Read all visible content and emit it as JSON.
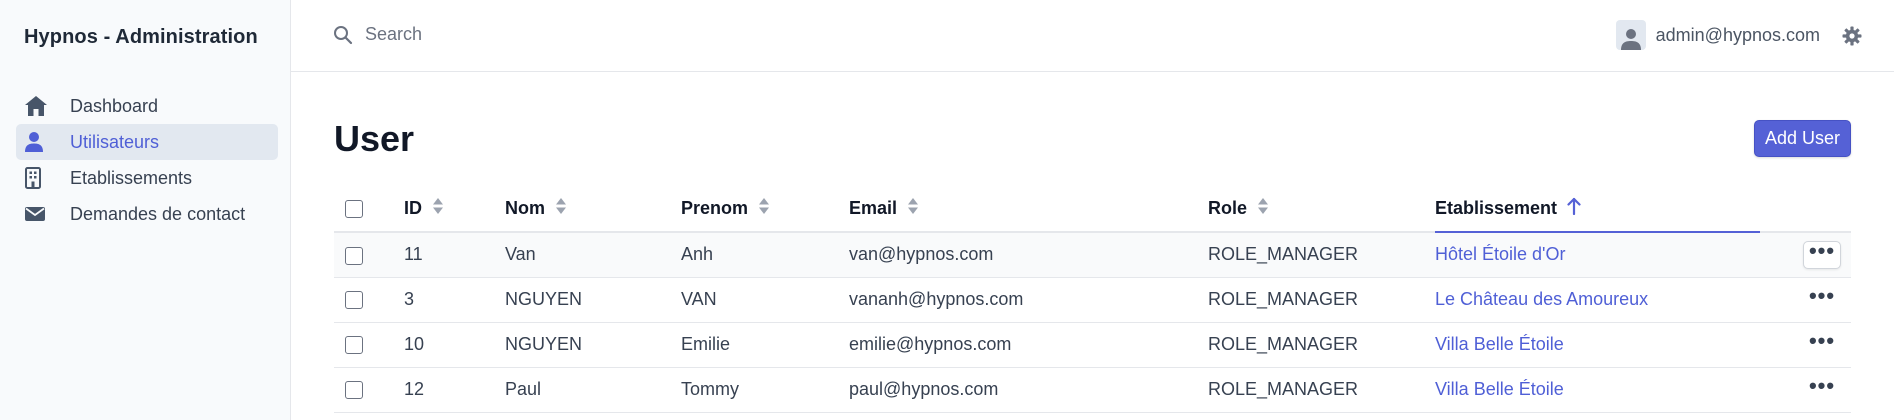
{
  "app": {
    "title": "Hypnos - Administration"
  },
  "sidebar": {
    "items": [
      {
        "label": "Dashboard",
        "icon": "home-icon",
        "active": false
      },
      {
        "label": "Utilisateurs",
        "icon": "user-icon",
        "active": true
      },
      {
        "label": "Etablissements",
        "icon": "building-icon",
        "active": false
      },
      {
        "label": "Demandes de contact",
        "icon": "envelope-icon",
        "active": false
      }
    ]
  },
  "header": {
    "search_placeholder": "Search",
    "user_email": "admin@hypnos.com"
  },
  "page": {
    "title": "User",
    "add_button": "Add User"
  },
  "table": {
    "columns": [
      "ID",
      "Nom",
      "Prenom",
      "Email",
      "Role",
      "Etablissement"
    ],
    "sorted_column": "Etablissement",
    "sort_direction": "asc",
    "rows": [
      {
        "id": "11",
        "nom": "Van",
        "prenom": "Anh",
        "email": "van@hypnos.com",
        "role": "ROLE_MANAGER",
        "etablissement": "Hôtel Étoile d'Or"
      },
      {
        "id": "3",
        "nom": "NGUYEN",
        "prenom": "VAN",
        "email": "vananh@hypnos.com",
        "role": "ROLE_MANAGER",
        "etablissement": "Le Château des Amoureux"
      },
      {
        "id": "10",
        "nom": "NGUYEN",
        "prenom": "Emilie",
        "email": "emilie@hypnos.com",
        "role": "ROLE_MANAGER",
        "etablissement": "Villa Belle Étoile"
      },
      {
        "id": "12",
        "nom": "Paul",
        "prenom": "Tommy",
        "email": "paul@hypnos.com",
        "role": "ROLE_MANAGER",
        "etablissement": "Villa Belle Étoile"
      }
    ]
  },
  "colors": {
    "accent": "#5561d6",
    "link": "#4f5fd6",
    "sidebar_bg": "#f8fafc"
  }
}
